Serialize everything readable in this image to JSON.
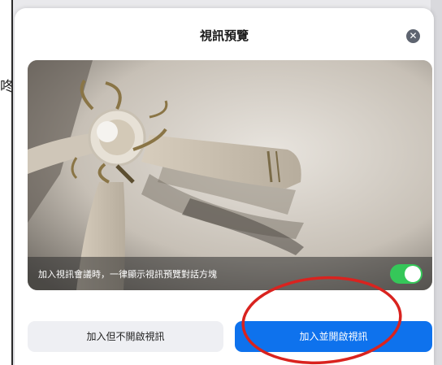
{
  "background": {
    "side_text": "咚"
  },
  "dialog": {
    "title": "視訊預覽",
    "close_icon": "close-icon",
    "preview": {
      "toggle_label": "加入視訊會議時，一律顯示視訊預覽對話方塊",
      "toggle_on": true
    },
    "buttons": {
      "join_without_video": "加入但不開啟視訊",
      "join_with_video": "加入並開啟視訊"
    }
  },
  "colors": {
    "primary": "#0e72ed",
    "toggle_on": "#35c759",
    "annotation": "#d9231f"
  }
}
